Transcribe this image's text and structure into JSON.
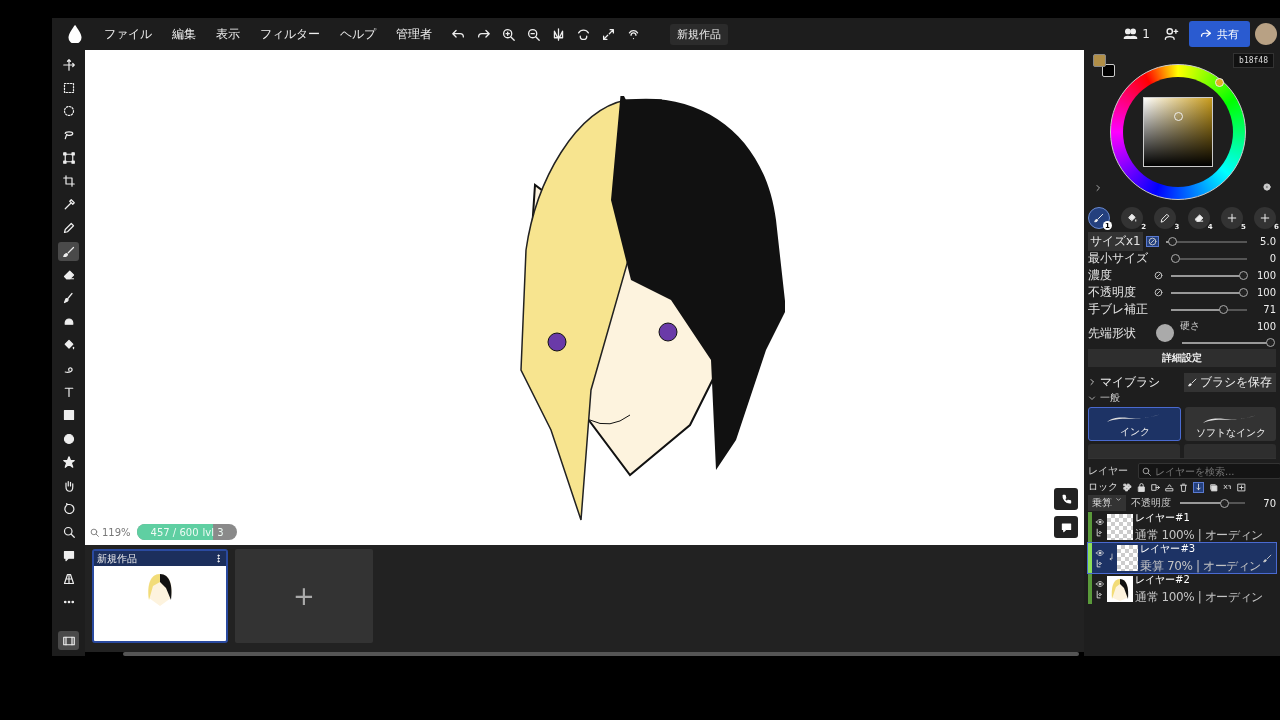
{
  "menu": [
    "ファイル",
    "編集",
    "表示",
    "フィルター",
    "ヘルプ",
    "管理者"
  ],
  "document_title": "新規作品",
  "header": {
    "user_count": "1",
    "share": "共有"
  },
  "tools": [
    {
      "kind": "move",
      "selected": false
    },
    {
      "kind": "rect-select",
      "selected": false
    },
    {
      "kind": "ellipse-select",
      "selected": false
    },
    {
      "kind": "lasso",
      "selected": false
    },
    {
      "kind": "transform",
      "selected": false
    },
    {
      "kind": "crop",
      "selected": false
    },
    {
      "kind": "eyedropper",
      "selected": false
    },
    {
      "kind": "pencil",
      "selected": false
    },
    {
      "kind": "brush",
      "selected": true
    },
    {
      "kind": "eraser",
      "selected": false
    },
    {
      "kind": "smudge",
      "selected": false
    },
    {
      "kind": "blur",
      "selected": false
    },
    {
      "kind": "bucket",
      "selected": false
    },
    {
      "kind": "liquify",
      "selected": false
    },
    {
      "kind": "text",
      "selected": false
    },
    {
      "kind": "rectangle",
      "selected": false
    },
    {
      "kind": "circle",
      "selected": false
    },
    {
      "kind": "star",
      "selected": false
    },
    {
      "kind": "hand",
      "selected": false
    },
    {
      "kind": "rotate",
      "selected": false
    },
    {
      "kind": "zoom",
      "selected": false
    },
    {
      "kind": "comment",
      "selected": false
    },
    {
      "kind": "perspective",
      "selected": false
    },
    {
      "kind": "more",
      "selected": false
    },
    {
      "kind": "filmstrip",
      "selected": true
    }
  ],
  "canvas": {
    "zoom": "119%",
    "stroke_count": "457 / 600",
    "level": 0.76,
    "level_label": "lvl 3"
  },
  "filmstrip": {
    "items": [
      {
        "title": "新規作品",
        "selected": true
      }
    ],
    "add": "+"
  },
  "color": {
    "hex": "b18f48"
  },
  "brush_slots": [
    {
      "number": "1",
      "kind": "brush",
      "selected": true
    },
    {
      "number": "2",
      "kind": "bucket",
      "selected": false
    },
    {
      "number": "3",
      "kind": "pencil",
      "selected": false
    },
    {
      "number": "4",
      "kind": "eraser",
      "selected": false
    },
    {
      "number": "5",
      "kind": "plus",
      "selected": false
    },
    {
      "number": "6",
      "kind": "plus",
      "selected": false
    }
  ],
  "sliders": [
    {
      "label": "サイズx1",
      "boxed": true,
      "pressure": true,
      "level": 0.03,
      "value": "5.0"
    },
    {
      "label": "最小サイズ",
      "boxed": false,
      "pressure": false,
      "level": 0,
      "value": "0"
    },
    {
      "label": "濃度",
      "boxed": false,
      "pressure": true,
      "level": 1,
      "value": "100"
    },
    {
      "label": "不透明度",
      "boxed": false,
      "pressure": true,
      "level": 1,
      "value": "100"
    },
    {
      "label": "手ブレ補正",
      "boxed": false,
      "pressure": false,
      "level": 0.71,
      "value": "71"
    }
  ],
  "tip": {
    "label": "先端形状",
    "hardness_label": "硬さ",
    "hardness_value": "100",
    "level": 1
  },
  "detail_button": "詳細設定",
  "my_brushes": {
    "label": "マイブラシ",
    "expanded": false,
    "save": "ブラシを保存"
  },
  "brush_group": {
    "label": "一般",
    "expanded": true,
    "brushes": [
      {
        "name": "インク",
        "selected": true
      },
      {
        "name": "ソフトなインク",
        "selected": false
      }
    ]
  },
  "layers": {
    "title": "レイヤー",
    "search_placeholder": "レイヤーを検索...",
    "lock_label": "ロック",
    "blend_mode": "乗算",
    "opacity_label": "不透明度",
    "level": 0.7,
    "opacity_value": "70",
    "items": [
      {
        "name": "レイヤー#1",
        "info": "通常 100% | オーディン",
        "selected": false,
        "clipped": false,
        "kind": "empty"
      },
      {
        "name": "レイヤー#3",
        "info": "乗算 70% | オーディン",
        "selected": true,
        "clipped": true,
        "kind": "empty"
      },
      {
        "name": "レイヤー#2",
        "info": "通常 100% | オーディン",
        "selected": false,
        "clipped": false,
        "kind": "drawing"
      }
    ]
  }
}
